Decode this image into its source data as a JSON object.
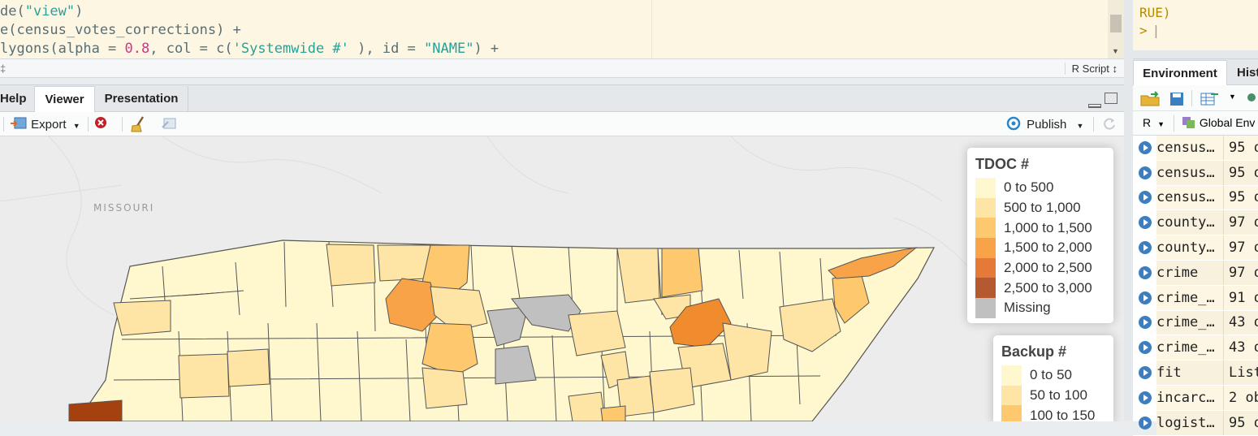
{
  "editor": {
    "lines": [
      {
        "parts": [
          {
            "t": "de(",
            "c": ""
          },
          {
            "t": "\"view\"",
            "c": "s"
          },
          {
            "t": ")",
            "c": ""
          }
        ]
      },
      {
        "parts": [
          {
            "t": "e(census_votes_corrections) +",
            "c": ""
          }
        ]
      },
      {
        "parts": [
          {
            "t": "lygons(alpha = ",
            "c": ""
          },
          {
            "t": "0.8",
            "c": "n"
          },
          {
            "t": ", col = c(",
            "c": ""
          },
          {
            "t": "'Systemwide #'",
            "c": "s"
          },
          {
            "t": " ), id = ",
            "c": ""
          },
          {
            "t": "\"NAME\"",
            "c": "s"
          },
          {
            "t": ") +",
            "c": ""
          }
        ]
      }
    ],
    "status_left": "‡",
    "language": "R Script ↕"
  },
  "viewer": {
    "tabs": [
      "Help",
      "Viewer",
      "Presentation"
    ],
    "active_tab": "Viewer",
    "toolbar": {
      "export_label": "Export",
      "publish_label": "Publish"
    },
    "map_label": "MISSOURI",
    "legend_tdoc": {
      "title": "TDOC #",
      "items": [
        {
          "label": "0 to 500",
          "color": "#fff8cf"
        },
        {
          "label": "500 to 1,000",
          "color": "#fee5a5"
        },
        {
          "label": "1,000 to 1,500",
          "color": "#fdc86e"
        },
        {
          "label": "1,500 to 2,000",
          "color": "#f9a348"
        },
        {
          "label": "2,000 to 2,500",
          "color": "#e57a38"
        },
        {
          "label": "2,500 to 3,000",
          "color": "#b55a30"
        },
        {
          "label": "Missing",
          "color": "#c0c0c0"
        }
      ]
    },
    "legend_backup": {
      "title": "Backup #",
      "items": [
        {
          "label": "0 to 50",
          "color": "#fff8cf"
        },
        {
          "label": "50 to 100",
          "color": "#fee5a5"
        },
        {
          "label": "100 to 150",
          "color": "#fdc86e"
        }
      ]
    }
  },
  "console": {
    "lines": [
      "RUE)",
      ">"
    ]
  },
  "environment": {
    "tabs": [
      "Environment",
      "Hist"
    ],
    "scope": "R",
    "global_env": "Global Env",
    "rows": [
      {
        "name": "census…",
        "value": "95 o"
      },
      {
        "name": "census…",
        "value": "95 o"
      },
      {
        "name": "census…",
        "value": "95 o"
      },
      {
        "name": "county…",
        "value": "97 o"
      },
      {
        "name": "county…",
        "value": "97 o"
      },
      {
        "name": "crime",
        "value": "97 o"
      },
      {
        "name": "crime_…",
        "value": "91 o"
      },
      {
        "name": "crime_…",
        "value": "43 o"
      },
      {
        "name": "crime_…",
        "value": "43 o"
      },
      {
        "name": "fit",
        "value": "List"
      },
      {
        "name": "incarc…",
        "value": "2 ob"
      },
      {
        "name": "logist…",
        "value": "95 o"
      }
    ]
  }
}
